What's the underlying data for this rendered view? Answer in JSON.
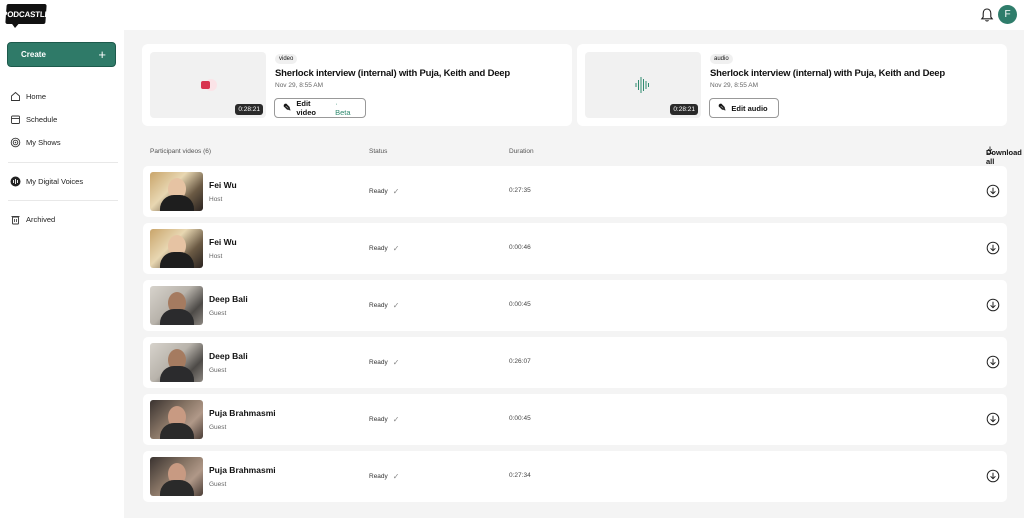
{
  "app": {
    "logo_text": "PODCASTLE",
    "avatar_initial": "F"
  },
  "sidebar": {
    "create_label": "Create",
    "items": [
      {
        "label": "Home",
        "icon": "home-icon"
      },
      {
        "label": "Schedule",
        "icon": "calendar-icon"
      },
      {
        "label": "My Shows",
        "icon": "podcast-icon"
      },
      {
        "label": "My Digital Voices",
        "icon": "voice-icon"
      },
      {
        "label": "Archived",
        "icon": "trash-icon"
      }
    ]
  },
  "cards": [
    {
      "type": "video",
      "title": "Sherlock interview (internal) with Puja, Keith and Deep",
      "date": "Nov 29, 8:55 AM",
      "duration": "0:28:21",
      "edit_label": "Edit video",
      "edit_suffix": "· Beta"
    },
    {
      "type": "audio",
      "title": "Sherlock interview (internal) with Puja, Keith and Deep",
      "date": "Nov 29, 8:55 AM",
      "duration": "0:28:21",
      "edit_label": "Edit audio"
    }
  ],
  "list": {
    "col_participants": "Participant videos (6)",
    "col_status": "Status",
    "col_duration": "Duration",
    "download_all": "Download all",
    "rows": [
      {
        "name": "Fei Wu",
        "role": "Host",
        "status": "Ready",
        "duration": "0:27:35"
      },
      {
        "name": "Fei Wu",
        "role": "Host",
        "status": "Ready",
        "duration": "0:00:46"
      },
      {
        "name": "Deep Bali",
        "role": "Guest",
        "status": "Ready",
        "duration": "0:00:45"
      },
      {
        "name": "Deep Bali",
        "role": "Guest",
        "status": "Ready",
        "duration": "0:26:07"
      },
      {
        "name": "Puja Brahmasmi",
        "role": "Guest",
        "status": "Ready",
        "duration": "0:00:45"
      },
      {
        "name": "Puja Brahmasmi",
        "role": "Guest",
        "status": "Ready",
        "duration": "0:27:34"
      }
    ]
  },
  "colors": {
    "accent": "#2f7a68",
    "beta": "#2f8a6f",
    "record_red": "#d8344f",
    "waveform": "#2f8a6f"
  }
}
